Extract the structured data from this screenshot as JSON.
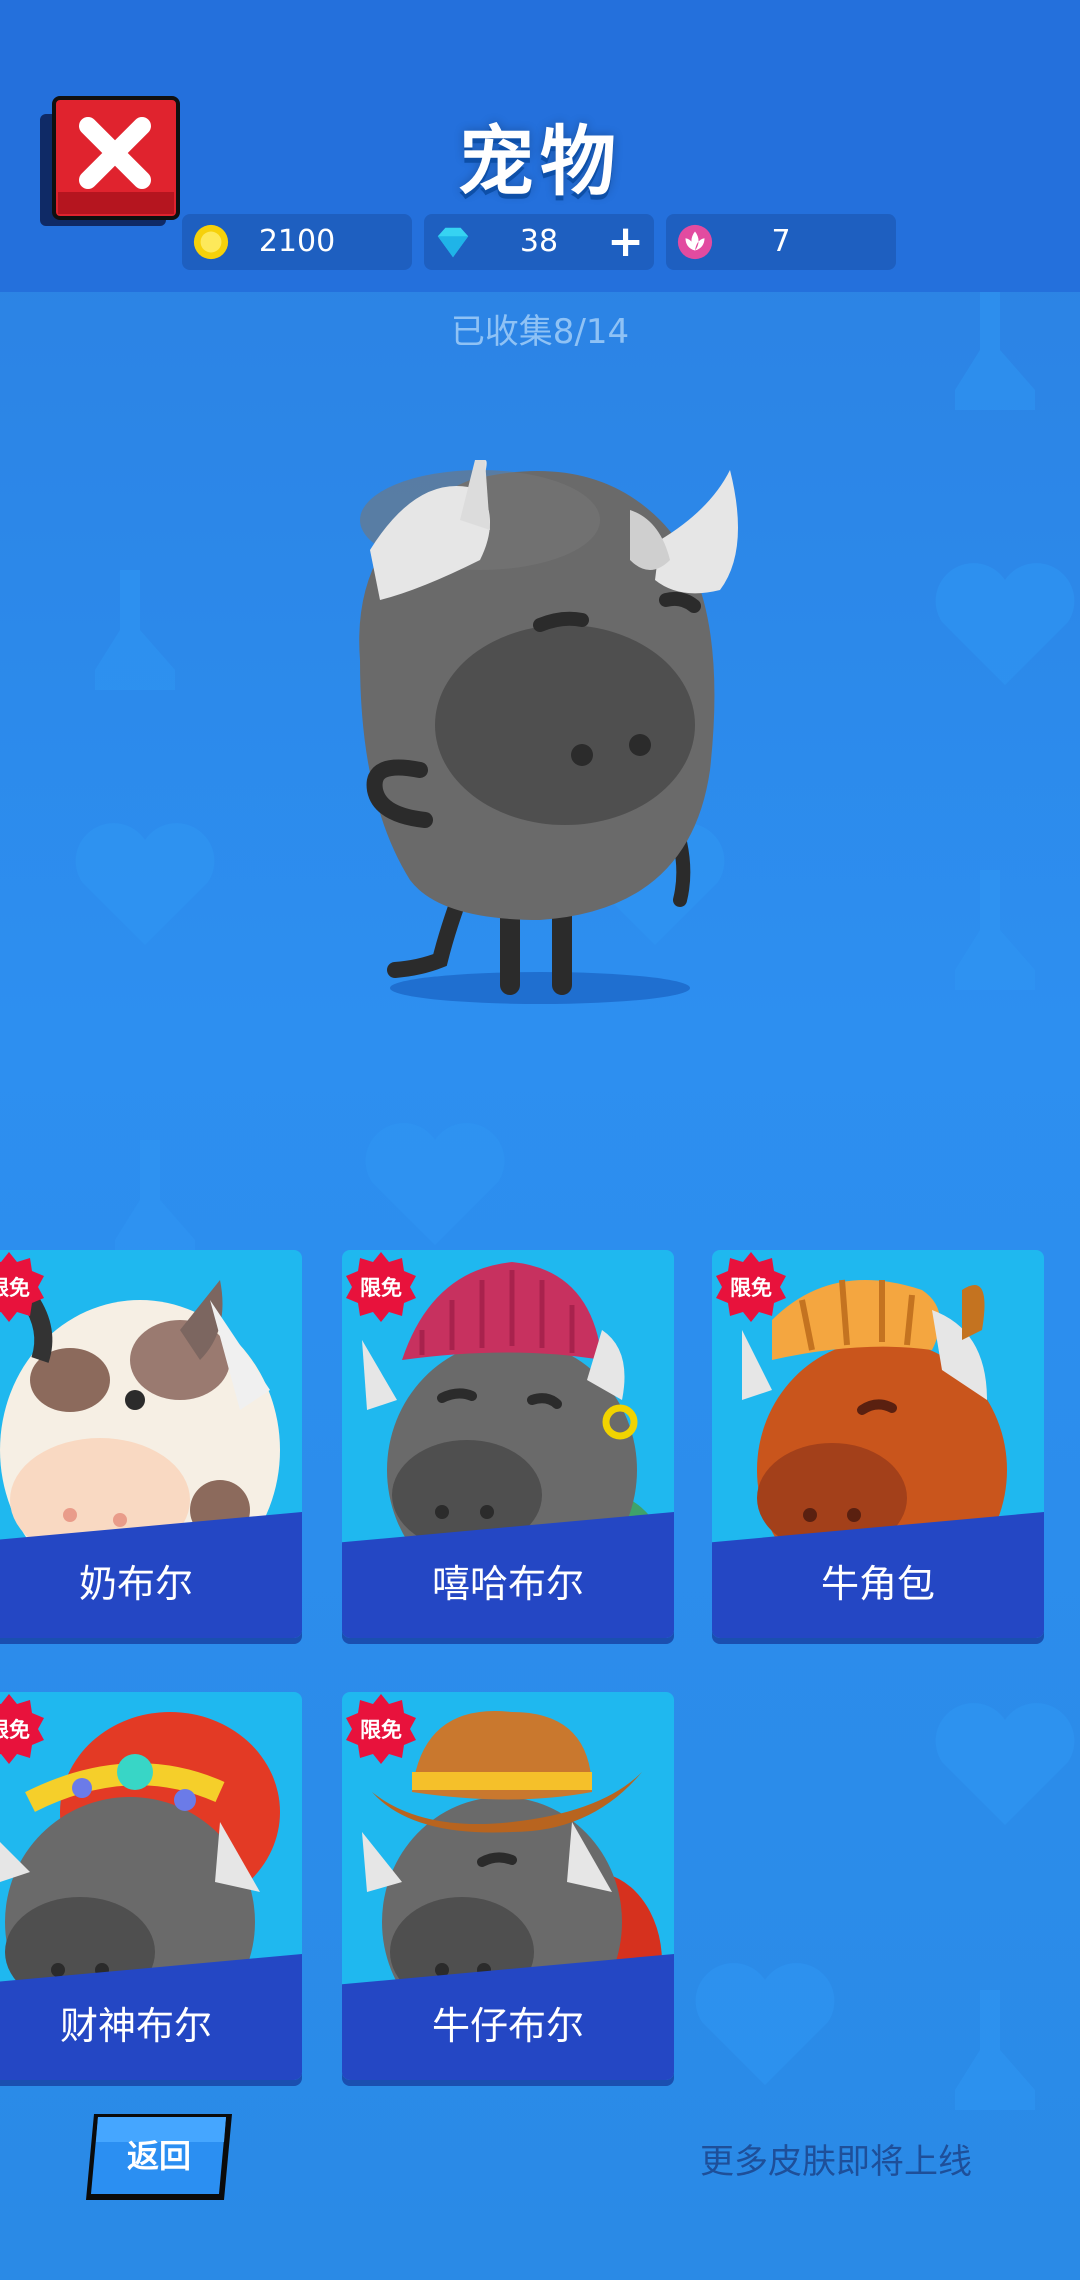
{
  "header": {
    "title": "宠物",
    "close_icon": "close-icon",
    "currencies": [
      {
        "icon": "coin-icon",
        "value": "2100"
      },
      {
        "icon": "diamond-icon",
        "value": "38",
        "add_label": "+"
      },
      {
        "icon": "flower-token-icon",
        "value": "7"
      }
    ]
  },
  "collection": {
    "text": "已收集8/14"
  },
  "selected_pet": {
    "icon": "bull-pet-icon"
  },
  "pets": [
    {
      "name": "奶布尔",
      "badge": "限免",
      "icon": "milk-cow-icon"
    },
    {
      "name": "嘻哈布尔",
      "badge": "限免",
      "icon": "hiphop-bull-icon"
    },
    {
      "name": "牛角包",
      "badge": "限免",
      "icon": "croissant-bull-icon"
    },
    {
      "name": "财神布尔",
      "badge": "限免",
      "icon": "fortune-bull-icon"
    },
    {
      "name": "牛仔布尔",
      "badge": "限免",
      "icon": "cowboy-bull-icon"
    }
  ],
  "footer": {
    "back_label": "返回",
    "more_text": "更多皮肤即将上线"
  },
  "colors": {
    "background": "#2a8ae6",
    "card": "#1fb8ef",
    "card_band": "#2447c4",
    "badge": "#e8123c",
    "close": "#e0232e"
  }
}
